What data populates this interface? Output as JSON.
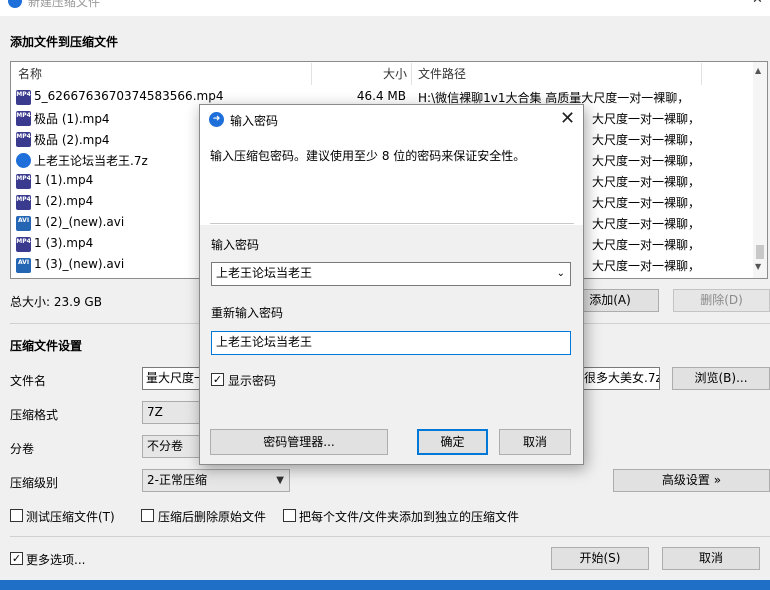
{
  "main": {
    "window_title": "新建压缩文件",
    "add_section_title": "添加文件到压缩文件",
    "columns": {
      "name": "名称",
      "size": "大小",
      "path": "文件路径"
    },
    "files": [
      {
        "name": "5_6266763670374583566.mp4",
        "size": "46.4 MB",
        "path": "H:\\微信裸聊1v1大合集 高质量大尺度一对一裸聊，",
        "type": "mp4"
      },
      {
        "name": "极品 (1).mp4",
        "size": "",
        "path": "大尺度一对一裸聊，",
        "type": "mp4"
      },
      {
        "name": "极品 (2).mp4",
        "size": "",
        "path": "大尺度一对一裸聊，",
        "type": "mp4"
      },
      {
        "name": "上老王论坛当老王.7z",
        "size": "",
        "path": "大尺度一对一裸聊，",
        "type": "7z"
      },
      {
        "name": "1 (1).mp4",
        "size": "",
        "path": "大尺度一对一裸聊，",
        "type": "mp4"
      },
      {
        "name": "1 (2).mp4",
        "size": "",
        "path": "大尺度一对一裸聊，",
        "type": "mp4"
      },
      {
        "name": "1 (2)_(new).avi",
        "size": "",
        "path": "大尺度一对一裸聊，",
        "type": "avi"
      },
      {
        "name": "1 (3).mp4",
        "size": "",
        "path": "大尺度一对一裸聊，",
        "type": "mp4"
      },
      {
        "name": "1 (3)_(new).avi",
        "size": "",
        "path": "大尺度一对一裸聊，",
        "type": "avi"
      }
    ],
    "total_size": "总大小: 23.9 GB",
    "add_button": "添加(A)",
    "delete_button": "删除(D)",
    "settings_title": "压缩文件设置",
    "filename_label": "文件名",
    "filename_value_left": "量大尺度一",
    "filename_value_right": "很多大美女.7z",
    "browse_button": "浏览(B)...",
    "format_label": "压缩格式",
    "format_value": "7Z",
    "split_label": "分卷",
    "split_value": "不分卷",
    "level_label": "压缩级别",
    "level_value": "2-正常压缩",
    "advanced_button": "高级设置 »",
    "test_option": "测试压缩文件(T)",
    "delete_after_option": "压缩后删除原始文件",
    "separate_option": "把每个文件/文件夹添加到独立的压缩文件",
    "more_options": "更多选项...",
    "start_button": "开始(S)",
    "cancel_button": "取消",
    "icon_labels": {
      "mp4": "MP4",
      "avi": "AVI"
    }
  },
  "dialog": {
    "title": "输入密码",
    "description": "输入压缩包密码。建议使用至少 8 位的密码来保证安全性。",
    "password_label": "输入密码",
    "password_value": "上老王论坛当老王",
    "reenter_label": "重新输入密码",
    "reenter_value": "上老王论坛当老王",
    "show_password_label": "显示密码",
    "show_password_checked": true,
    "manager_button": "密码管理器...",
    "ok_button": "确定",
    "cancel_button": "取消"
  },
  "colors": {
    "accent": "#0078d7",
    "taskbar": "#1f6fc7"
  }
}
